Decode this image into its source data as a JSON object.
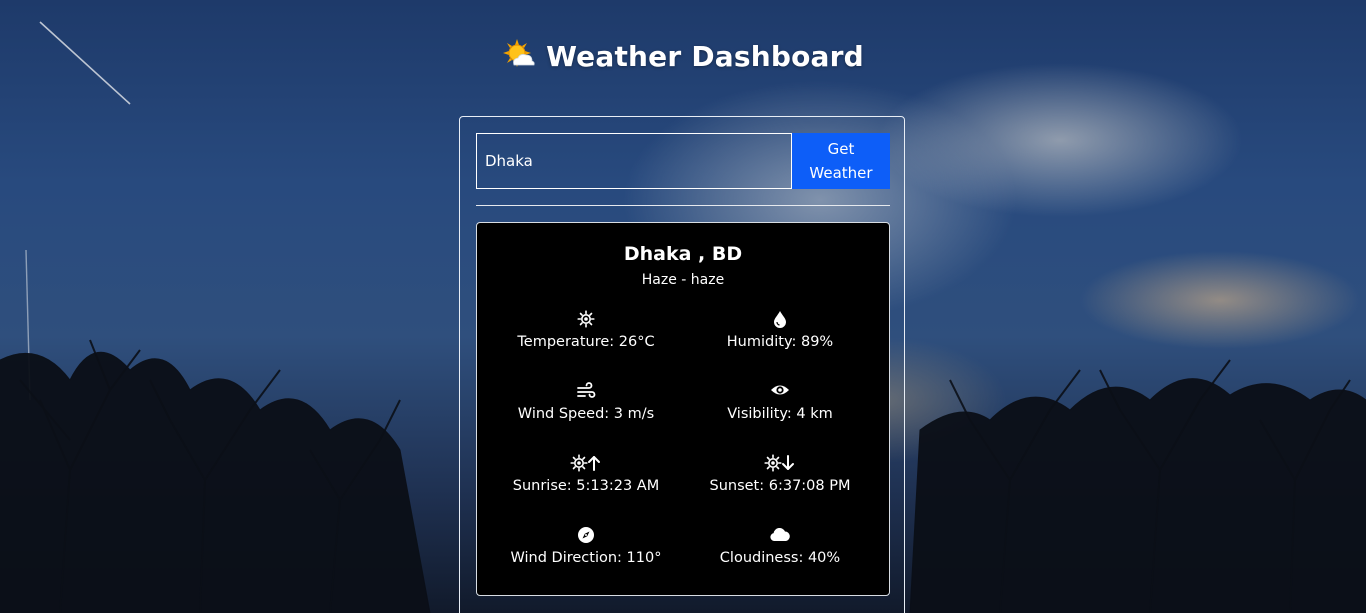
{
  "header": {
    "title": "Weather Dashboard",
    "icon": "sun-behind-cloud-icon"
  },
  "search": {
    "value": "Dhaka",
    "button_label_line1": "Get",
    "button_label_line2": "Weather"
  },
  "weather": {
    "location": "Dhaka , BD",
    "description": "Haze - haze",
    "stats": {
      "temperature": {
        "icon": "temperature-sun-icon",
        "label": "Temperature: 26°C"
      },
      "humidity": {
        "icon": "water-drop-icon",
        "label": "Humidity: 89%"
      },
      "wind_speed": {
        "icon": "wind-icon",
        "label": "Wind Speed: 3 m/s"
      },
      "visibility": {
        "icon": "eye-icon",
        "label": "Visibility: 4 km"
      },
      "sunrise": {
        "icon": "sunrise-icon",
        "label": "Sunrise: 5:13:23 AM"
      },
      "sunset": {
        "icon": "sunset-icon",
        "label": "Sunset: 6:37:08 PM"
      },
      "wind_direction": {
        "icon": "compass-icon",
        "label": "Wind Direction: 110°"
      },
      "cloudiness": {
        "icon": "cloud-icon",
        "label": "Cloudiness: 40%"
      }
    }
  },
  "colors": {
    "button_blue": "#0d5ef8",
    "card_background": "#000000",
    "text": "#ffffff"
  }
}
